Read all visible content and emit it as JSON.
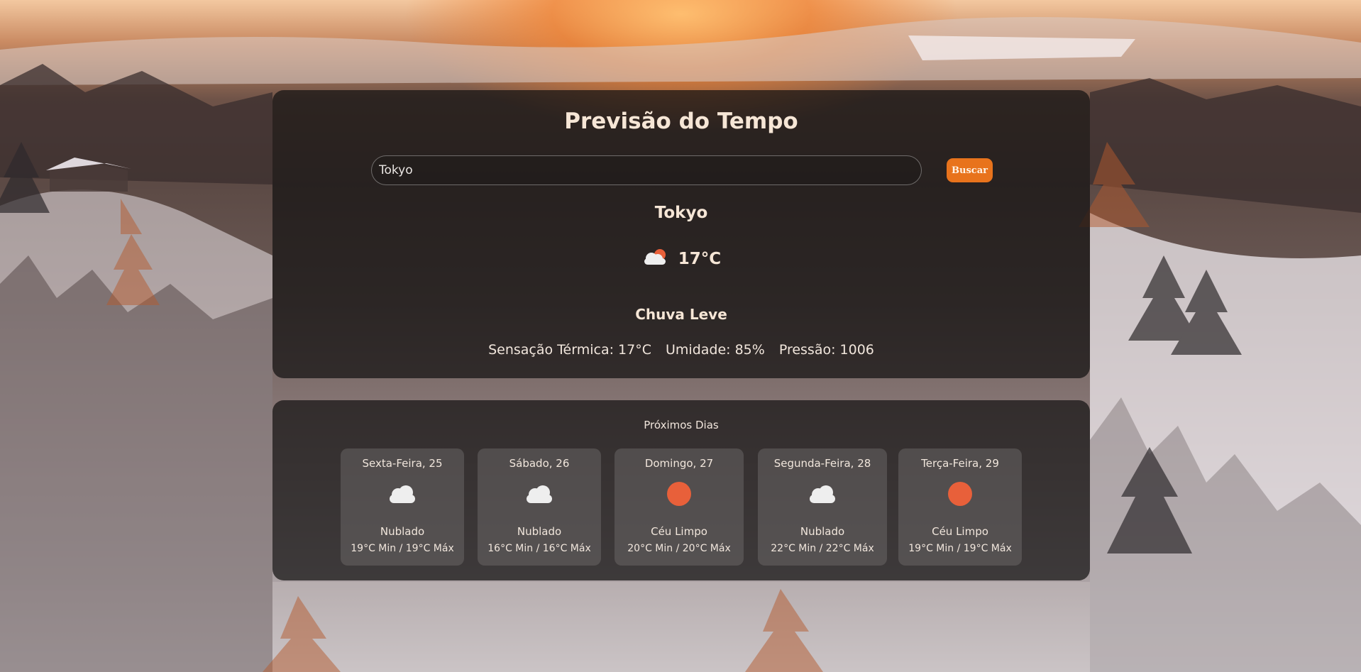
{
  "app": {
    "title": "Previsão do Tempo"
  },
  "search": {
    "value": "Tokyo",
    "button_label": "Buscar"
  },
  "current": {
    "city": "Tokyo",
    "temperature": "17°C",
    "icon": "cloud-sun-icon",
    "condition": "Chuva Leve",
    "feels_like": "Sensação Térmica: 17°C",
    "humidity": "Umidade: 85%",
    "pressure": "Pressão: 1006"
  },
  "forecast": {
    "heading": "Próximos Dias",
    "days": [
      {
        "name": "Sexta-Feira, 25",
        "icon": "cloud-icon",
        "condition": "Nublado",
        "range": "19°C Min / 19°C Máx"
      },
      {
        "name": "Sábado, 26",
        "icon": "cloud-icon",
        "condition": "Nublado",
        "range": "16°C Min / 16°C Máx"
      },
      {
        "name": "Domingo, 27",
        "icon": "sun-icon",
        "condition": "Céu Limpo",
        "range": "20°C Min / 20°C Máx"
      },
      {
        "name": "Segunda-Feira, 28",
        "icon": "cloud-icon",
        "condition": "Nublado",
        "range": "22°C Min / 22°C Máx"
      },
      {
        "name": "Terça-Feira, 29",
        "icon": "sun-icon",
        "condition": "Céu Limpo",
        "range": "19°C Min / 19°C Máx"
      }
    ]
  },
  "colors": {
    "accent": "#e8731c",
    "card_background": "rgba(20,18,18,0.72)",
    "sun": "#e8603a"
  }
}
